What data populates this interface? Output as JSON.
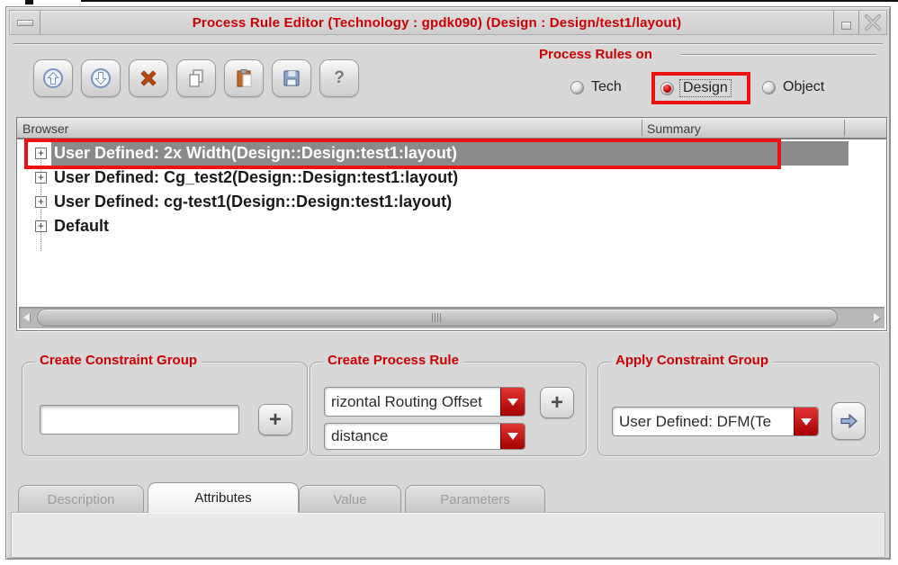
{
  "window": {
    "title": "Process Rule Editor (Technology : gpdk090) (Design : Design/test1/layout)"
  },
  "toolbar": {
    "buttons": [
      "move-up",
      "move-down",
      "delete",
      "copy",
      "paste",
      "save",
      "help"
    ],
    "help_label": "?"
  },
  "process_rules_on": {
    "label": "Process Rules on",
    "options": [
      {
        "label": "Tech",
        "selected": false
      },
      {
        "label": "Design",
        "selected": true,
        "annotated": true
      },
      {
        "label": "Object",
        "selected": false
      }
    ]
  },
  "browser": {
    "columns": [
      "Browser",
      "Summary"
    ],
    "expander_glyph": "+",
    "items": [
      {
        "label": "User Defined: 2x Width(Design::Design:test1:layout)",
        "selected": true,
        "annotated": true
      },
      {
        "label": "User Defined: Cg_test2(Design::Design:test1:layout)",
        "selected": false
      },
      {
        "label": "User Defined: cg-test1(Design::Design:test1:layout)",
        "selected": false
      },
      {
        "label": "Default",
        "selected": false
      }
    ]
  },
  "create_constraint_group": {
    "title": "Create Constraint Group",
    "input_value": "",
    "add_label": "+"
  },
  "create_process_rule": {
    "title": "Create Process Rule",
    "rule_dropdown": "rizontal Routing Offset",
    "type_dropdown": "distance",
    "add_label": "+"
  },
  "apply_constraint_group": {
    "title": "Apply Constraint Group",
    "dropdown": "User Defined: DFM(Te"
  },
  "tabs": [
    {
      "label": "Description",
      "state": "disabled"
    },
    {
      "label": "Attributes",
      "state": "active"
    },
    {
      "label": "Value",
      "state": "disabled"
    },
    {
      "label": "Parameters",
      "state": "disabled"
    }
  ],
  "colors": {
    "accent_red": "#cc0000",
    "annotation_red": "#ee1111",
    "selection_gray": "#8a8a8a",
    "dropdown_red": "#b80000"
  }
}
